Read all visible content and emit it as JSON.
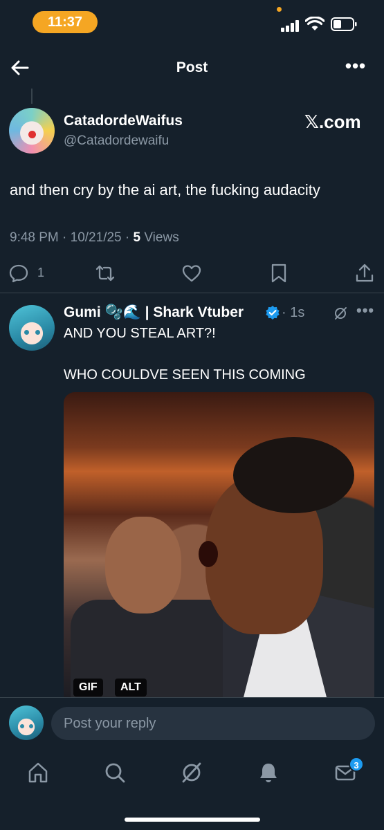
{
  "status_bar": {
    "time": "11:37"
  },
  "header": {
    "title": "Post",
    "more": "•••"
  },
  "main_post": {
    "author_name": "CatadordeWaifus",
    "author_handle": "@Catadordewaifu",
    "source_badge": "𝕏.com",
    "text": "and then cry by the ai art, the fucking audacity",
    "timestamp": "9:48 PM · 10/21/25 · ",
    "views_count": "5",
    "views_label": " Views",
    "reply_count": "1"
  },
  "reply_post": {
    "author_name": "Gumi 🫧🌊 | Shark Vtuber",
    "time": "· 1s",
    "more": "•••",
    "line1": "AND YOU STEAL ART?!",
    "line2": "WHO COULDVE SEEN THIS COMING",
    "media_badge_gif": "GIF",
    "media_badge_alt": "ALT"
  },
  "reply_bar": {
    "placeholder": "Post your reply"
  },
  "tab_bar": {
    "messages_badge": "3"
  },
  "colors": {
    "background": "#15202b",
    "accent": "#1d9bf0",
    "muted": "#8b98a5",
    "status_pill": "#f5a623"
  }
}
